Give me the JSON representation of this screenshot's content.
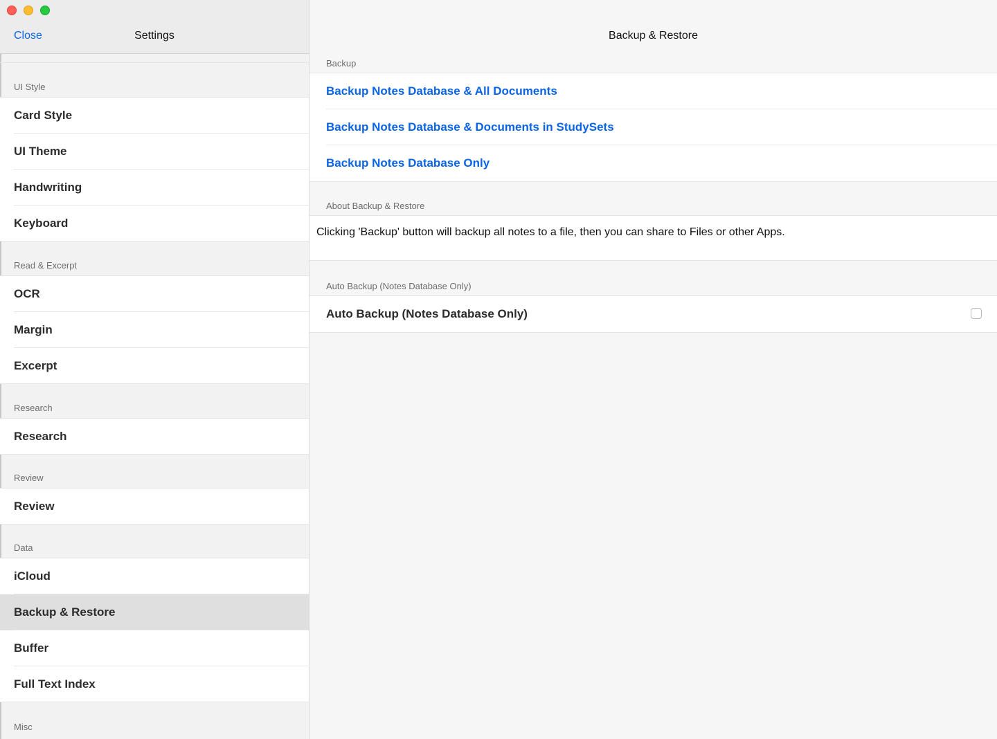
{
  "window": {
    "controls": [
      "close",
      "minimize",
      "maximize"
    ]
  },
  "sidebar": {
    "close_label": "Close",
    "title": "Settings",
    "sections": [
      {
        "header": "UI Style",
        "items": [
          "Card Style",
          "UI Theme",
          "Handwriting",
          "Keyboard"
        ]
      },
      {
        "header": "Read & Excerpt",
        "items": [
          "OCR",
          "Margin",
          "Excerpt"
        ]
      },
      {
        "header": "Research",
        "items": [
          "Research"
        ]
      },
      {
        "header": "Review",
        "items": [
          "Review"
        ]
      },
      {
        "header": "Data",
        "items": [
          "iCloud",
          "Backup & Restore",
          "Buffer",
          "Full Text Index"
        ]
      },
      {
        "header": "Misc",
        "items": []
      }
    ],
    "selected_item": "Backup & Restore"
  },
  "main": {
    "title": "Backup & Restore",
    "backup_section": {
      "header": "Backup",
      "actions": [
        "Backup Notes Database & All Documents",
        "Backup Notes Database & Documents in StudySets",
        "Backup Notes Database Only"
      ]
    },
    "about_section": {
      "header": "About Backup & Restore",
      "text": "Clicking 'Backup' button will backup all notes to a file, then you can share to Files or other Apps."
    },
    "auto_section": {
      "header": "Auto Backup (Notes Database Only)",
      "toggle_label": "Auto Backup (Notes Database Only)",
      "checked": false
    }
  },
  "colors": {
    "accent": "#0a64e4",
    "selected_row": "#dfdfdf",
    "traffic_close": "#fe5f57",
    "traffic_min": "#febc2e",
    "traffic_max": "#28c840"
  }
}
